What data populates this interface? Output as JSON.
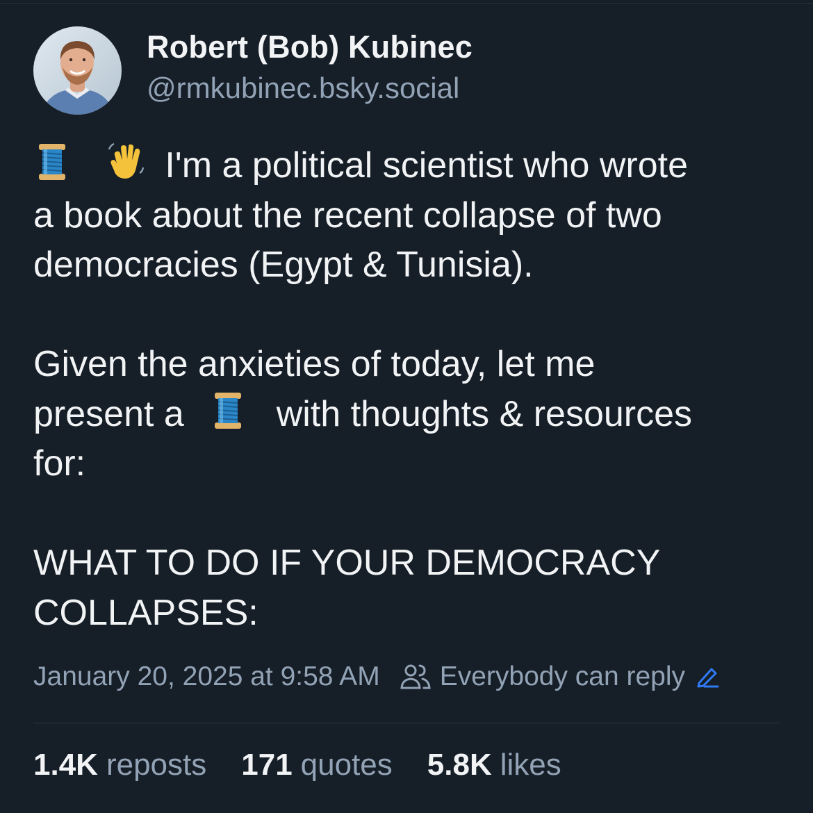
{
  "author": {
    "display_name": "Robert (Bob) Kubinec",
    "handle": "@rmkubinec.bsky.social",
    "avatar_icon": "profile-photo"
  },
  "post": {
    "line1_text": "I'm a political scientist who wrote",
    "line1_emoji": [
      "spool-of-thread-emoji",
      "waving-hand-emoji"
    ],
    "line2": "a book about the recent collapse of two",
    "line3": "democracies (Egypt & Tunisia).",
    "line5": "Given the anxieties of today, let me",
    "line6_before": "present a",
    "line6_emoji": "spool-of-thread-emoji",
    "line6_after": "with thoughts & resources",
    "line7": "for:",
    "line9": "WHAT TO DO IF YOUR DEMOCRACY",
    "line10": "COLLAPSES:"
  },
  "meta": {
    "timestamp": "January 20, 2025 at 9:58 AM",
    "reply_setting": "Everybody can reply",
    "reply_icon": "people-icon",
    "edit_icon": "pencil-icon"
  },
  "stats": {
    "reposts_count": "1.4K",
    "reposts_label": "reposts",
    "quotes_count": "171",
    "quotes_label": "quotes",
    "likes_count": "5.8K",
    "likes_label": "likes"
  },
  "colors": {
    "background": "#161e27",
    "text": "#f1f3f5",
    "muted": "#93a3b6",
    "accent": "#2f7bf5"
  }
}
